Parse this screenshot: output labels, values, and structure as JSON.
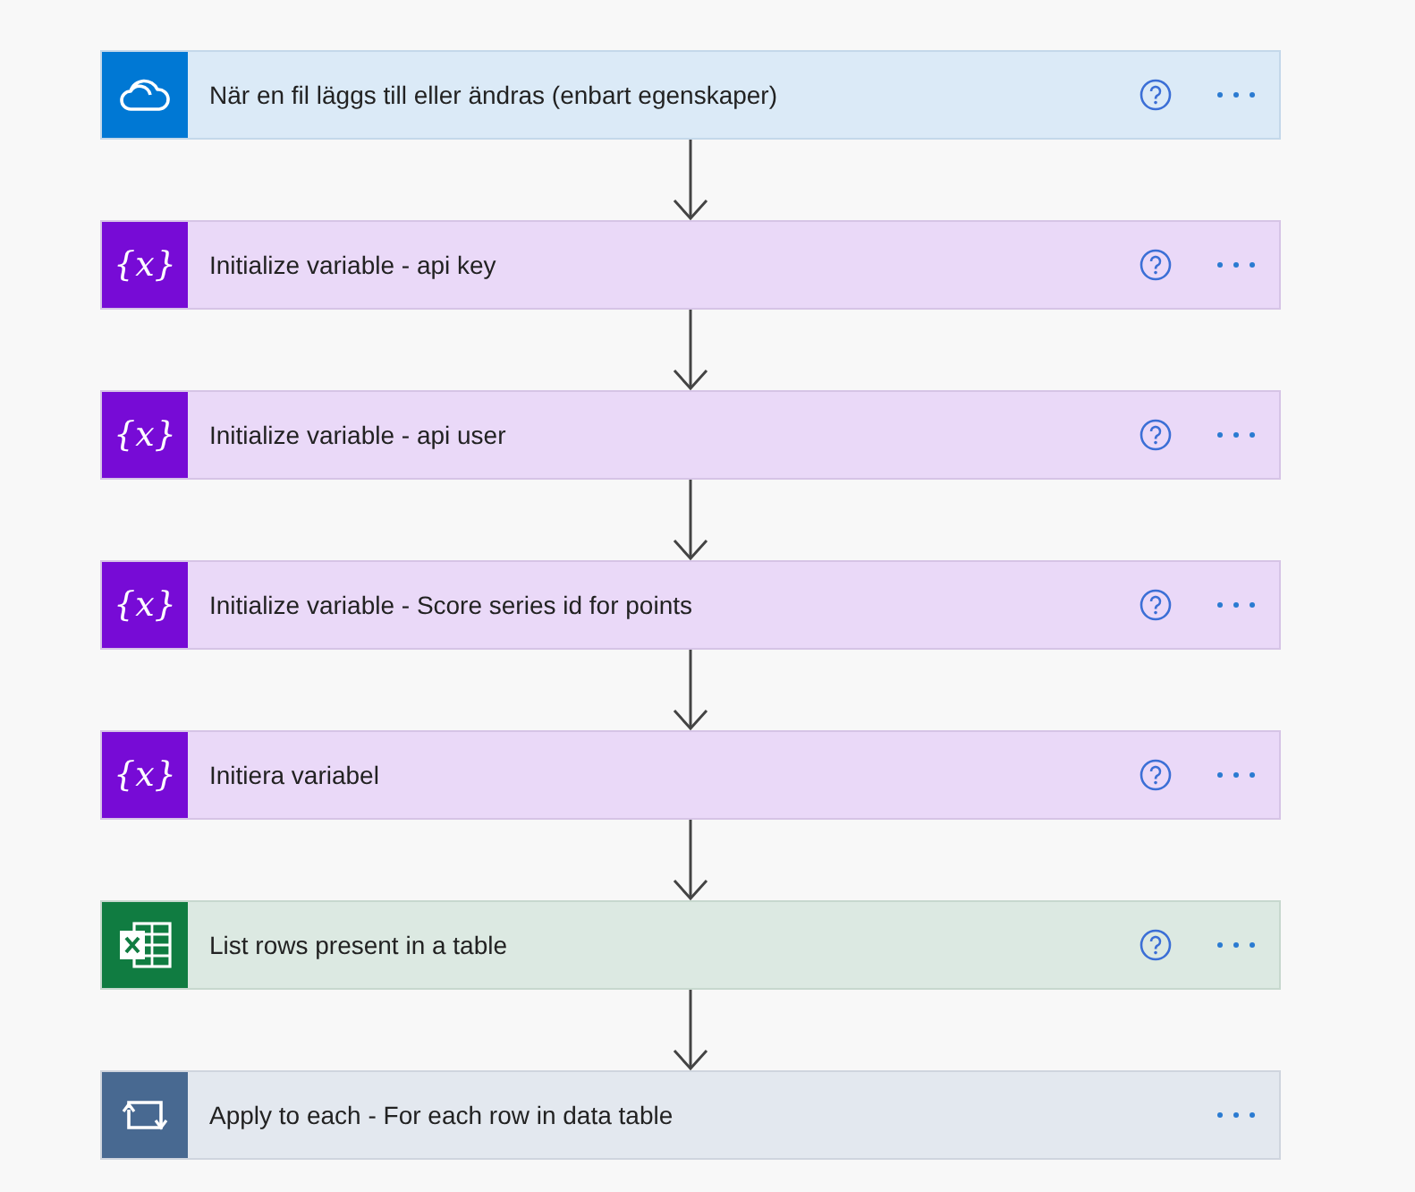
{
  "steps": [
    {
      "kind": "onedrive",
      "title": "När en fil läggs till eller ändras (enbart egenskaper)",
      "help": true
    },
    {
      "kind": "variable",
      "icon_text": "{x}",
      "title": "Initialize variable - api key",
      "help": true
    },
    {
      "kind": "variable",
      "icon_text": "{x}",
      "title": "Initialize variable - api user",
      "help": true
    },
    {
      "kind": "variable",
      "icon_text": "{x}",
      "title": "Initialize variable - Score series id for points",
      "help": true
    },
    {
      "kind": "variable",
      "icon_text": "{x}",
      "title": "Initiera variabel",
      "help": true
    },
    {
      "kind": "excel",
      "title": "List rows present in a table",
      "help": true
    },
    {
      "kind": "loop",
      "title": "Apply to each - For each row in data table",
      "help": false
    }
  ]
}
